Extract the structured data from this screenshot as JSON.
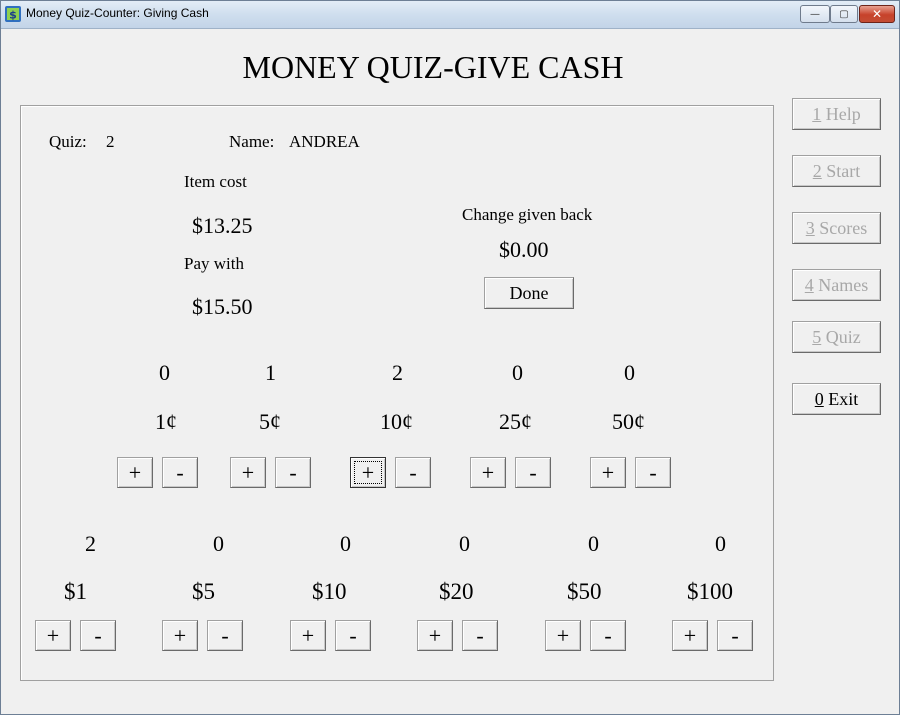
{
  "window": {
    "title": "Money Quiz-Counter: Giving Cash",
    "icon": "money-quiz-app-icon",
    "controls": {
      "minimize": "—",
      "maximize": "▢",
      "close": "✕"
    }
  },
  "heading": "MONEY QUIZ-GIVE CASH",
  "quiz": {
    "label": "Quiz:",
    "value": "2"
  },
  "name": {
    "label": "Name:",
    "value": "ANDREA"
  },
  "item_cost": {
    "label": "Item cost",
    "value": "$13.25"
  },
  "pay_with": {
    "label": "Pay with",
    "value": "$15.50"
  },
  "change": {
    "label": "Change given back",
    "value": "$0.00"
  },
  "done_label": "Done",
  "plus_label": "+",
  "minus_label": "-",
  "coins": [
    {
      "count": "0",
      "label": "1¢"
    },
    {
      "count": "1",
      "label": "5¢"
    },
    {
      "count": "2",
      "label": "10¢"
    },
    {
      "count": "0",
      "label": "25¢"
    },
    {
      "count": "0",
      "label": "50¢"
    }
  ],
  "bills": [
    {
      "count": "2",
      "label": "$1"
    },
    {
      "count": "0",
      "label": "$5"
    },
    {
      "count": "0",
      "label": "$10"
    },
    {
      "count": "0",
      "label": "$20"
    },
    {
      "count": "0",
      "label": "$50"
    },
    {
      "count": "0",
      "label": "$100"
    }
  ],
  "side_menu": [
    {
      "key": "1",
      "text": " Help",
      "enabled": false
    },
    {
      "key": "2",
      "text": " Start",
      "enabled": false
    },
    {
      "key": "3",
      "text": " Scores",
      "enabled": false
    },
    {
      "key": "4",
      "text": " Names",
      "enabled": false
    },
    {
      "key": "5",
      "text": " Quiz",
      "enabled": false
    },
    {
      "key": "0",
      "text": " Exit",
      "enabled": true
    }
  ],
  "colors": {
    "disabled_text": "#a8a8a8",
    "face": "#f0f0f0",
    "close_button": "#c7422b"
  }
}
